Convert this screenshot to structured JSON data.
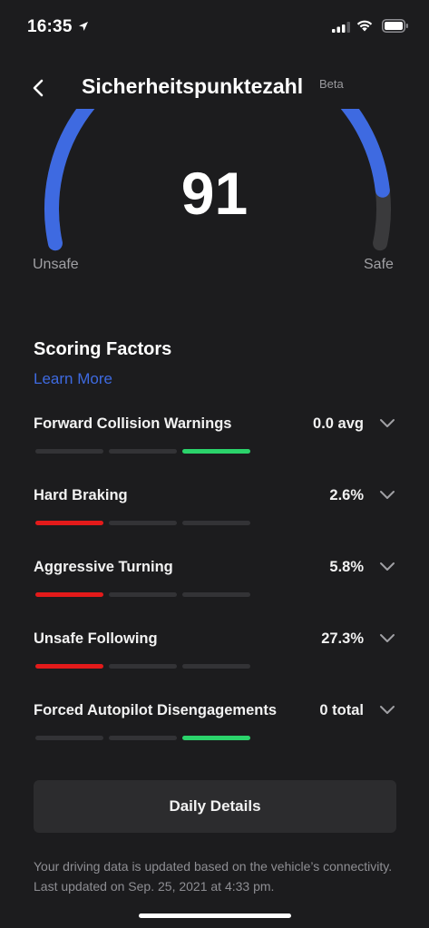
{
  "status_bar": {
    "time": "16:35"
  },
  "header": {
    "title": "Sicherheitspunktezahl",
    "badge": "Beta"
  },
  "gauge": {
    "score": "91",
    "score_value": 91,
    "left_label": "Unsafe",
    "right_label": "Safe",
    "arc_color": "#3e6ae1",
    "track_color": "#3a3a3c"
  },
  "scoring": {
    "title": "Scoring Factors",
    "learn_more": "Learn More",
    "factors": [
      {
        "label": "Forward Collision Warnings",
        "value": "0.0 avg",
        "level": 3,
        "color": "green"
      },
      {
        "label": "Hard Braking",
        "value": "2.6%",
        "level": 1,
        "color": "red"
      },
      {
        "label": "Aggressive Turning",
        "value": "5.8%",
        "level": 1,
        "color": "red"
      },
      {
        "label": "Unsafe Following",
        "value": "27.3%",
        "level": 1,
        "color": "red"
      },
      {
        "label": "Forced Autopilot Disengagements",
        "value": "0 total",
        "level": 3,
        "color": "green"
      }
    ]
  },
  "actions": {
    "daily_details": "Daily Details"
  },
  "footer": {
    "note": "Your driving data is updated based on the vehicle’s connectivity. Last updated on Sep. 25, 2021 at 4:33 pm."
  },
  "colors": {
    "background": "#1c1c1e",
    "accent": "#3e6ae1",
    "bad": "#e31a1a",
    "good": "#2bd36b"
  }
}
